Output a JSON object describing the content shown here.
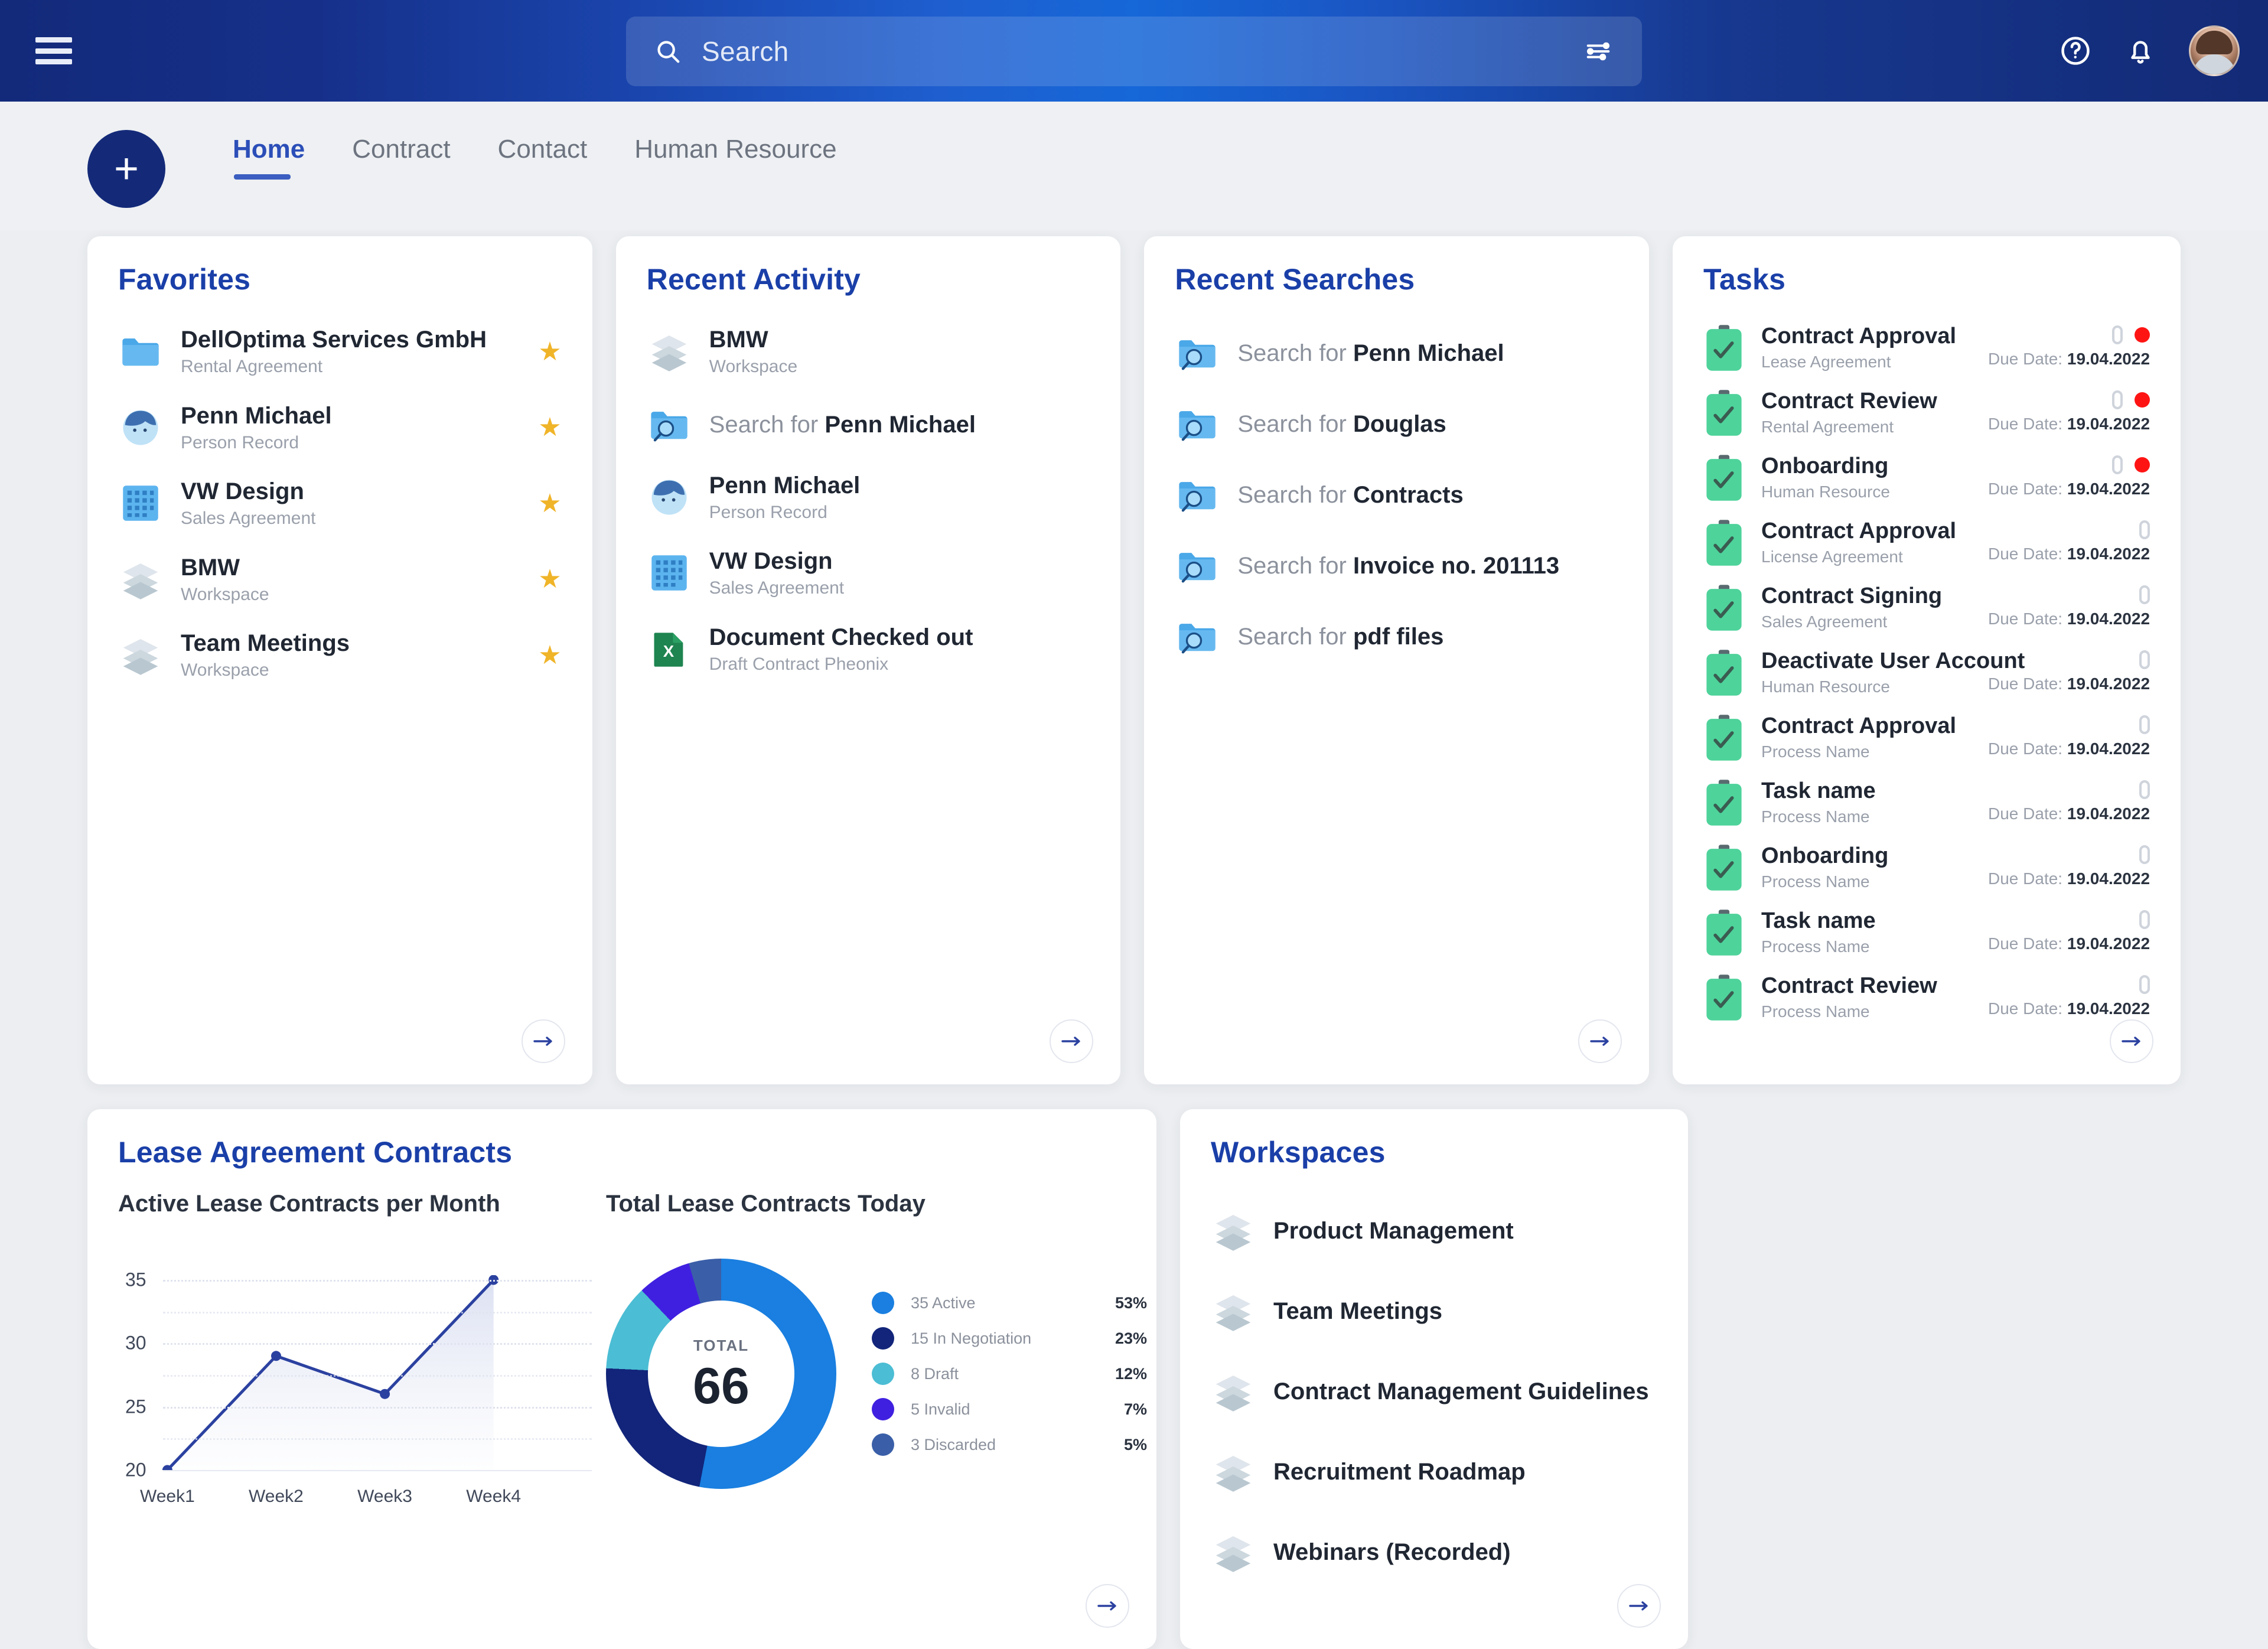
{
  "topbar": {
    "menu_icon": "hamburger-icon",
    "search_placeholder": "Search",
    "search_value": "",
    "search_icon": "search-icon",
    "filter_icon": "sliders-filter-icon",
    "help_icon": "help-circle-icon",
    "notifications_icon": "bell-icon",
    "avatar": "user-avatar"
  },
  "nav": {
    "add_label": "+",
    "tabs": [
      {
        "label": "Home",
        "active": true
      },
      {
        "label": "Contract",
        "active": false
      },
      {
        "label": "Contact",
        "active": false
      },
      {
        "label": "Human Resource",
        "active": false
      }
    ]
  },
  "favorites": {
    "title": "Favorites",
    "items": [
      {
        "name": "DellOptima Services GmbH",
        "type": "Rental Agreement",
        "icon": "folder-icon",
        "starred": "★"
      },
      {
        "name": "Penn Michael",
        "type": "Person Record",
        "icon": "person-icon",
        "starred": "★"
      },
      {
        "name": "VW Design",
        "type": "Sales Agreement",
        "icon": "grid-icon",
        "starred": "★"
      },
      {
        "name": "BMW",
        "type": "Workspace",
        "icon": "stack-icon",
        "starred": "★"
      },
      {
        "name": "Team Meetings",
        "type": "Workspace",
        "icon": "stack-icon",
        "starred": "★"
      }
    ]
  },
  "recent_activity": {
    "title": "Recent Activity",
    "items": [
      {
        "name": "BMW",
        "type": "Workspace",
        "icon": "stack-icon",
        "prefix": ""
      },
      {
        "name": "Penn Michael",
        "type": "",
        "icon": "search-folder-icon",
        "prefix": "Search for "
      },
      {
        "name": "Penn Michael",
        "type": "Person Record",
        "icon": "person-icon",
        "prefix": ""
      },
      {
        "name": "VW Design",
        "type": "Sales Agreement",
        "icon": "grid-icon",
        "prefix": ""
      },
      {
        "name": "Document Checked out",
        "type": "Draft Contract Pheonix",
        "icon": "excel-icon",
        "prefix": ""
      }
    ]
  },
  "recent_searches": {
    "title": "Recent Searches",
    "items": [
      {
        "prefix": "Search for ",
        "term": "Penn Michael",
        "icon": "search-folder-icon"
      },
      {
        "prefix": "Search for ",
        "term": "Douglas",
        "icon": "search-folder-icon"
      },
      {
        "prefix": "Search for ",
        "term": "Contracts",
        "icon": "search-folder-icon"
      },
      {
        "prefix": "Search for ",
        "term": "Invoice no. 201113",
        "icon": "search-folder-icon"
      },
      {
        "prefix": "Search for ",
        "term": "pdf files",
        "icon": "search-folder-icon"
      }
    ]
  },
  "tasks": {
    "title": "Tasks",
    "due_prefix": "Due Date: ",
    "items": [
      {
        "name": "Contract Approval",
        "process": "Lease Agreement",
        "due": "19.04.2022",
        "attachment": true,
        "priority": true
      },
      {
        "name": "Contract Review",
        "process": "Rental Agreement",
        "due": "19.04.2022",
        "attachment": true,
        "priority": true
      },
      {
        "name": "Onboarding",
        "process": "Human Resource",
        "due": "19.04.2022",
        "attachment": true,
        "priority": true
      },
      {
        "name": "Contract Approval",
        "process": "License Agreement",
        "due": "19.04.2022",
        "attachment": true,
        "priority": false
      },
      {
        "name": "Contract Signing",
        "process": "Sales Agreement",
        "due": "19.04.2022",
        "attachment": true,
        "priority": false
      },
      {
        "name": "Deactivate User Account",
        "process": "Human Resource",
        "due": "19.04.2022",
        "attachment": true,
        "priority": false
      },
      {
        "name": "Contract Approval",
        "process": "Process Name",
        "due": "19.04.2022",
        "attachment": true,
        "priority": false
      },
      {
        "name": "Task name",
        "process": "Process Name",
        "due": "19.04.2022",
        "attachment": true,
        "priority": false
      },
      {
        "name": "Onboarding",
        "process": "Process Name",
        "due": "19.04.2022",
        "attachment": true,
        "priority": false
      },
      {
        "name": "Task name",
        "process": "Process Name",
        "due": "19.04.2022",
        "attachment": true,
        "priority": false
      },
      {
        "name": "Contract Review",
        "process": "Process Name",
        "due": "19.04.2022",
        "attachment": true,
        "priority": false
      }
    ]
  },
  "workspaces": {
    "title": "Workspaces",
    "items": [
      {
        "name": "Product Management",
        "icon": "stack-icon"
      },
      {
        "name": "Team Meetings",
        "icon": "stack-icon"
      },
      {
        "name": "Contract Management Guidelines",
        "icon": "stack-icon"
      },
      {
        "name": "Recruitment Roadmap",
        "icon": "stack-icon"
      },
      {
        "name": "Webinars (Recorded)",
        "icon": "stack-icon"
      }
    ]
  },
  "lease_card": {
    "title": "Lease Agreement Contracts"
  },
  "chart_data": [
    {
      "type": "line",
      "title": "Active Lease Contracts per Month",
      "categories": [
        "Week1",
        "Week2",
        "Week3",
        "Week4"
      ],
      "values": [
        20,
        29,
        26,
        35
      ],
      "xlabel": "",
      "ylabel": "",
      "ylim": [
        20,
        35
      ],
      "yticks": [
        20,
        25,
        30,
        35
      ],
      "grid": true,
      "line_color": "#2b41a0",
      "legend": "none"
    },
    {
      "type": "pie",
      "title": "Total Lease Contracts Today",
      "center_label": "TOTAL",
      "center_value": "66",
      "labels": [
        "35 Active",
        "15 In Negotiation",
        "8 Draft",
        "5 Invalid",
        "3 Discarded"
      ],
      "values": [
        35,
        15,
        8,
        5,
        3
      ],
      "percents": [
        "53%",
        "23%",
        "12%",
        "7%",
        "5%"
      ],
      "colors": [
        "#1a7fe0",
        "#12257a",
        "#4bbdd4",
        "#4020e0",
        "#3a5fa8"
      ],
      "legend": "right"
    }
  ],
  "colors": {
    "brand_navy": "#142a79",
    "accent_blue": "#1a3fa8",
    "star_gold": "#f0b429",
    "task_green": "#4ed39b",
    "priority_red": "#ff1414"
  }
}
